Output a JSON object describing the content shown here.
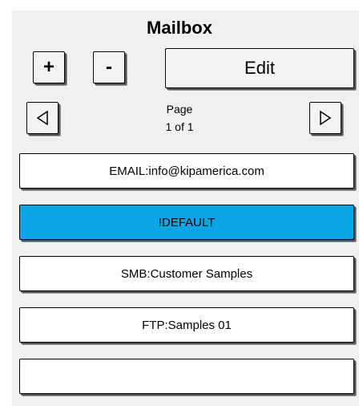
{
  "title": "Mailbox",
  "toolbar": {
    "add_label": "+",
    "remove_label": "-",
    "edit_label": "Edit"
  },
  "pager": {
    "page_word": "Page",
    "page_count": "1 of 1"
  },
  "mailboxes": [
    {
      "label": "EMAIL:info@kipamerica.com",
      "selected": false
    },
    {
      "label": "!DEFAULT",
      "selected": true
    },
    {
      "label": "SMB:Customer Samples",
      "selected": false
    },
    {
      "label": "FTP:Samples 01",
      "selected": false
    },
    {
      "label": "",
      "selected": false
    }
  ],
  "colors": {
    "selected": "#0aa5e6",
    "panel": "#f0f0f0"
  }
}
